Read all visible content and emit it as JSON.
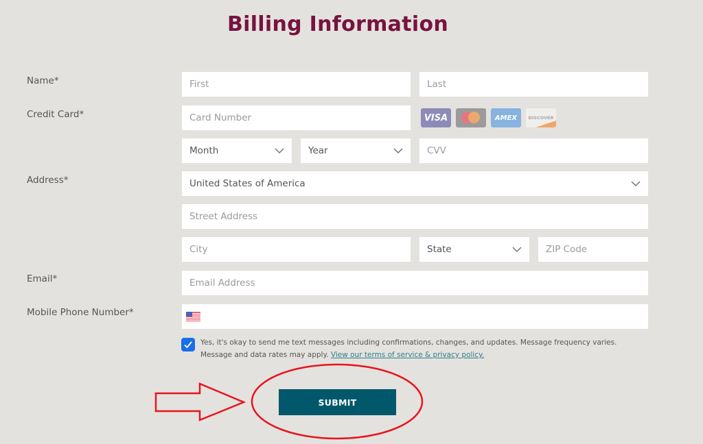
{
  "page": {
    "title": "Billing Information"
  },
  "labels": {
    "name": "Name*",
    "credit_card": "Credit Card*",
    "address": "Address*",
    "email": "Email*",
    "mobile": "Mobile Phone Number*"
  },
  "fields": {
    "first_name": {
      "placeholder": "First",
      "value": ""
    },
    "last_name": {
      "placeholder": "Last",
      "value": ""
    },
    "card_number": {
      "placeholder": "Card Number",
      "value": ""
    },
    "month": {
      "selected": "Month"
    },
    "year": {
      "selected": "Year"
    },
    "cvv": {
      "placeholder": "CVV",
      "value": ""
    },
    "country": {
      "selected": "United States of America"
    },
    "street": {
      "placeholder": "Street Address",
      "value": ""
    },
    "city": {
      "placeholder": "City",
      "value": ""
    },
    "state": {
      "selected": "State"
    },
    "zip": {
      "placeholder": "ZIP Code",
      "value": ""
    },
    "email": {
      "placeholder": "Email Address",
      "value": ""
    },
    "phone": {
      "country_flag": "us-flag-icon",
      "value": ""
    }
  },
  "card_logos": [
    {
      "name": "visa-icon",
      "text": "VISA"
    },
    {
      "name": "mastercard-icon",
      "text": ""
    },
    {
      "name": "amex-icon",
      "text": "AMEX"
    },
    {
      "name": "discover-icon",
      "text": "DISCOVER"
    }
  ],
  "consent": {
    "checked": true,
    "text": "Yes, it's okay to send me text messages including confirmations, changes, and updates. Message frequency varies. Message and data rates may apply.",
    "link_text": "View our terms of service & privacy policy."
  },
  "submit": {
    "label": "SUBMIT"
  },
  "colors": {
    "title": "#76133f",
    "submit_bg": "#02586b",
    "checkbox": "#1a6fe8",
    "annotation": "#e8141c",
    "background": "#e4e2df"
  },
  "annotations": {
    "arrow": "pointing-right-to-submit",
    "ellipse": "circled-submit-button"
  }
}
